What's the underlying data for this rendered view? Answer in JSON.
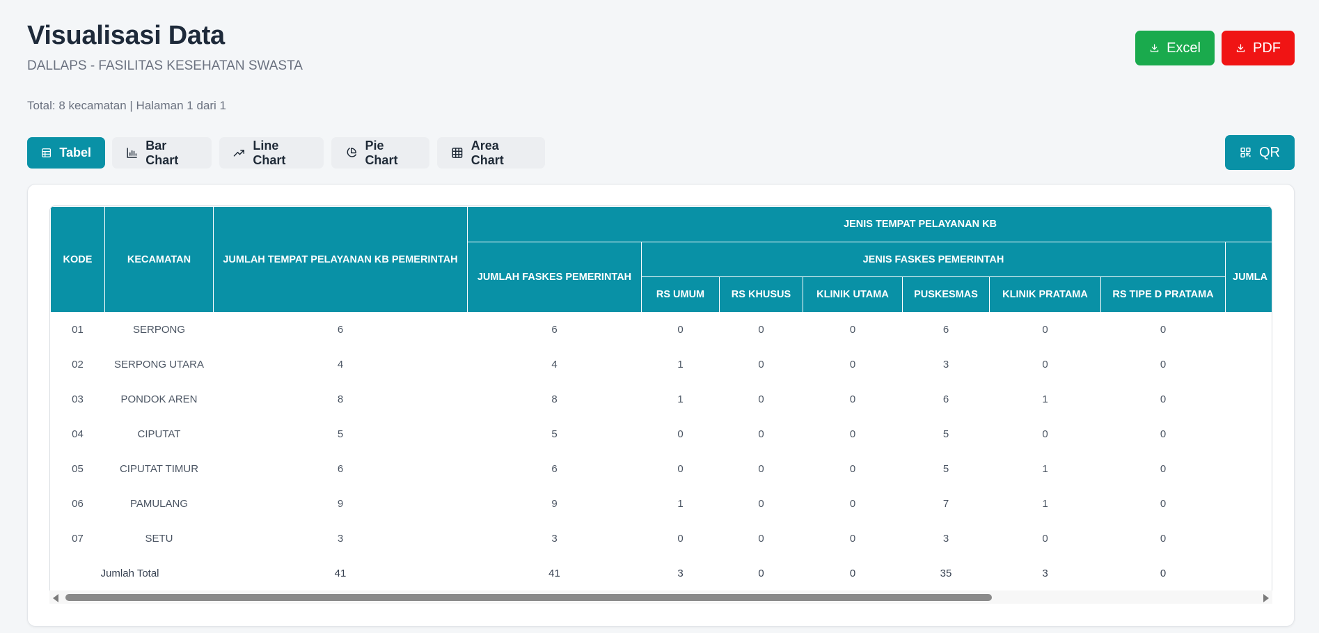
{
  "header": {
    "title": "Visualisasi Data",
    "subtitle": "DALLAPS - FASILITAS KESEHATAN SWASTA",
    "summary": "Total: 8 kecamatan | Halaman 1 dari 1"
  },
  "export": {
    "excel_label": "Excel",
    "pdf_label": "PDF",
    "excel_color": "#1aaa4d",
    "pdf_color": "#f01414"
  },
  "view_tabs": [
    {
      "label": "Tabel",
      "icon": "table-icon",
      "active": true
    },
    {
      "label": "Bar Chart",
      "icon": "bar-chart-icon",
      "active": false
    },
    {
      "label": "Line Chart",
      "icon": "trend-line-icon",
      "active": false
    },
    {
      "label": "Pie Chart",
      "icon": "pie-chart-icon",
      "active": false
    },
    {
      "label": "Area Chart",
      "icon": "grid-icon",
      "active": false
    }
  ],
  "qr": {
    "label": "QR",
    "icon": "qr-code-icon"
  },
  "accent_color": "#0991a6",
  "table": {
    "headers": {
      "kode": "KODE",
      "kecamatan": "KECAMATAN",
      "jumlah_pemerintah": "JUMLAH TEMPAT PELAYANAN KB PEMERINTAH",
      "jenis_tempat": "JENIS TEMPAT PELAYANAN KB",
      "jumlah_faskes": "JUMLAH FASKES PEMERINTAH",
      "jenis_faskes": "JENIS FASKES PEMERINTAH",
      "rs_umum": "RS UMUM",
      "rs_khusus": "RS KHUSUS",
      "klinik_utama": "KLINIK UTAMA",
      "puskesmas": "PUSKESMAS",
      "klinik_pratama": "KLINIK PRATAMA",
      "rs_tipe_d": "RS TIPE D PRATAMA",
      "jumlah_cut": "JUMLA"
    },
    "rows": [
      {
        "kode": "01",
        "kecamatan": "SERPONG",
        "jumlah": "6",
        "faskes": "6",
        "rs_umum": "0",
        "rs_khusus": "0",
        "klinik_utama": "0",
        "puskesmas": "6",
        "klinik_pratama": "0",
        "rs_tipe_d": "0"
      },
      {
        "kode": "02",
        "kecamatan": "SERPONG UTARA",
        "jumlah": "4",
        "faskes": "4",
        "rs_umum": "1",
        "rs_khusus": "0",
        "klinik_utama": "0",
        "puskesmas": "3",
        "klinik_pratama": "0",
        "rs_tipe_d": "0"
      },
      {
        "kode": "03",
        "kecamatan": "PONDOK AREN",
        "jumlah": "8",
        "faskes": "8",
        "rs_umum": "1",
        "rs_khusus": "0",
        "klinik_utama": "0",
        "puskesmas": "6",
        "klinik_pratama": "1",
        "rs_tipe_d": "0"
      },
      {
        "kode": "04",
        "kecamatan": "CIPUTAT",
        "jumlah": "5",
        "faskes": "5",
        "rs_umum": "0",
        "rs_khusus": "0",
        "klinik_utama": "0",
        "puskesmas": "5",
        "klinik_pratama": "0",
        "rs_tipe_d": "0"
      },
      {
        "kode": "05",
        "kecamatan": "CIPUTAT TIMUR",
        "jumlah": "6",
        "faskes": "6",
        "rs_umum": "0",
        "rs_khusus": "0",
        "klinik_utama": "0",
        "puskesmas": "5",
        "klinik_pratama": "1",
        "rs_tipe_d": "0"
      },
      {
        "kode": "06",
        "kecamatan": "PAMULANG",
        "jumlah": "9",
        "faskes": "9",
        "rs_umum": "1",
        "rs_khusus": "0",
        "klinik_utama": "0",
        "puskesmas": "7",
        "klinik_pratama": "1",
        "rs_tipe_d": "0"
      },
      {
        "kode": "07",
        "kecamatan": "SETU",
        "jumlah": "3",
        "faskes": "3",
        "rs_umum": "0",
        "rs_khusus": "0",
        "klinik_utama": "0",
        "puskesmas": "3",
        "klinik_pratama": "0",
        "rs_tipe_d": "0"
      }
    ],
    "total": {
      "label": "Jumlah Total",
      "jumlah": "41",
      "faskes": "41",
      "rs_umum": "3",
      "rs_khusus": "0",
      "klinik_utama": "0",
      "puskesmas": "35",
      "klinik_pratama": "3",
      "rs_tipe_d": "0"
    }
  }
}
